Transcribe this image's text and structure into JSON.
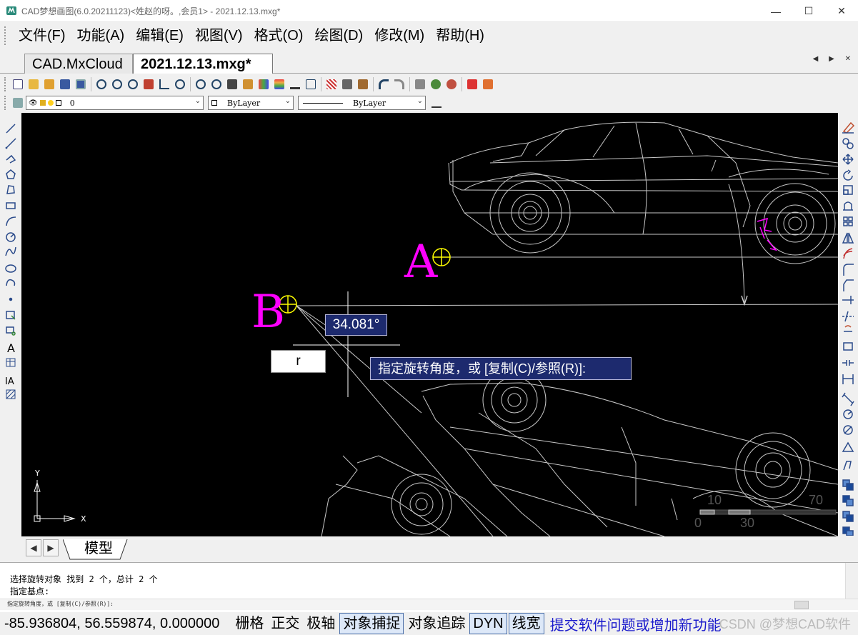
{
  "titlebar": {
    "title": "CAD梦想画图(6.0.20211123)<姓赵的呀。,会员1> - 2021.12.13.mxg*",
    "minimize": "—",
    "maximize": "☐",
    "close": "✕"
  },
  "menu": [
    {
      "label": "文件(F)"
    },
    {
      "label": "功能(A)"
    },
    {
      "label": "编辑(E)"
    },
    {
      "label": "视图(V)"
    },
    {
      "label": "格式(O)"
    },
    {
      "label": "绘图(D)"
    },
    {
      "label": "修改(M)"
    },
    {
      "label": "帮助(H)"
    }
  ],
  "tabs": {
    "inactive": "CAD.MxCloud",
    "active": "2021.12.13.mxg*",
    "nav": "◀ ▶ ✕"
  },
  "properties": {
    "layer_value": "0",
    "color_value": "ByLayer",
    "linetype_value": "ByLayer"
  },
  "canvas": {
    "label_a": "A",
    "label_b": "B",
    "angle_readout": "34.081°",
    "input_value": "r",
    "prompt": "指定旋转角度，或 [复制(C)/参照(R)]:",
    "ucs_x": "X",
    "ucs_y": "Y",
    "scale_labels": [
      "10",
      "70",
      "0",
      "30"
    ],
    "colors": {
      "background": "#000000",
      "geometry": "#c8c8c8",
      "label": "#ff00ff",
      "cursor": "#ffff00"
    }
  },
  "layout": {
    "model_tab": "模型"
  },
  "command": {
    "line1": "选择旋转对象   找到 2 个，总计 2 个",
    "line2": "指定基点:",
    "line3": "指定旋转角度，或 [复制(C)/参照(R)]:"
  },
  "status": {
    "coords": "-85.936804,  56.559874,  0.000000",
    "buttons": [
      {
        "label": "栅格",
        "on": false
      },
      {
        "label": "正交",
        "on": false
      },
      {
        "label": "极轴",
        "on": false
      },
      {
        "label": "对象捕捉",
        "on": true
      },
      {
        "label": "对象追踪",
        "on": false
      },
      {
        "label": "DYN",
        "on": true
      },
      {
        "label": "线宽",
        "on": true
      }
    ],
    "feedback_link": "提交软件问题或增加新功能",
    "watermark": "CSDN @梦想CAD软件"
  }
}
